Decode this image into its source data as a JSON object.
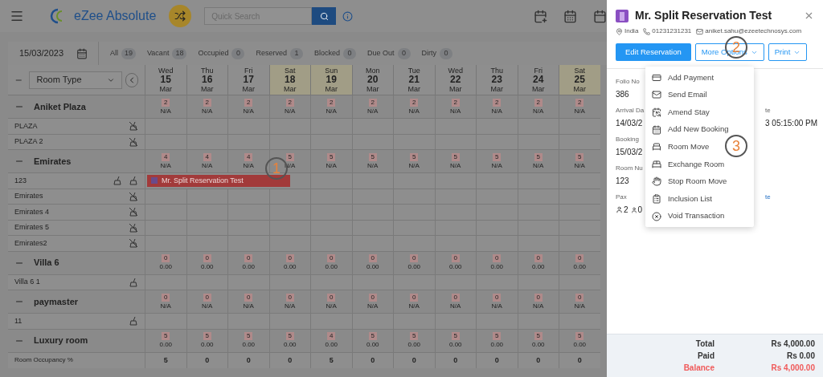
{
  "app": {
    "name": "eZee Absolute",
    "search": {
      "placeholder": "Quick Search"
    }
  },
  "filter_bar": {
    "date": "15/03/2023",
    "counts": [
      {
        "label": "All",
        "count": "19"
      },
      {
        "label": "Vacant",
        "count": "18"
      },
      {
        "label": "Occupied",
        "count": "0"
      },
      {
        "label": "Reserved",
        "count": "1"
      },
      {
        "label": "Blocked",
        "count": "0"
      },
      {
        "label": "Due Out",
        "count": "0"
      },
      {
        "label": "Dirty",
        "count": "0"
      }
    ]
  },
  "grid": {
    "room_type_select": "Room Type",
    "days": [
      {
        "weekday": "Wed",
        "day": "15",
        "month": "Mar",
        "weekend": false
      },
      {
        "weekday": "Thu",
        "day": "16",
        "month": "Mar",
        "weekend": false
      },
      {
        "weekday": "Fri",
        "day": "17",
        "month": "Mar",
        "weekend": false
      },
      {
        "weekday": "Sat",
        "day": "18",
        "month": "Mar",
        "weekend": true
      },
      {
        "weekday": "Sun",
        "day": "19",
        "month": "Mar",
        "weekend": true
      },
      {
        "weekday": "Mon",
        "day": "20",
        "month": "Mar",
        "weekend": false
      },
      {
        "weekday": "Tue",
        "day": "21",
        "month": "Mar",
        "weekend": false
      },
      {
        "weekday": "Wed",
        "day": "22",
        "month": "Mar",
        "weekend": false
      },
      {
        "weekday": "Thu",
        "day": "23",
        "month": "Mar",
        "weekend": false
      },
      {
        "weekday": "Fri",
        "day": "24",
        "month": "Mar",
        "weekend": false
      },
      {
        "weekday": "Sat",
        "day": "25",
        "month": "Mar",
        "weekend": true
      }
    ],
    "groups": [
      {
        "name": "Aniket Plaza",
        "availability": [
          "2",
          "2",
          "2",
          "2",
          "2",
          "2",
          "2",
          "2",
          "2",
          "2",
          "2"
        ],
        "rates": [
          "N/A",
          "N/A",
          "N/A",
          "N/A",
          "N/A",
          "N/A",
          "N/A",
          "N/A",
          "N/A",
          "N/A",
          "N/A"
        ],
        "rooms": [
          {
            "name": "PLAZA",
            "crossed": true,
            "extra_icon": false
          },
          {
            "name": "PLAZA 2",
            "crossed": true,
            "extra_icon": false
          }
        ]
      },
      {
        "name": "Emirates",
        "availability": [
          "4",
          "4",
          "4",
          "5",
          "5",
          "5",
          "5",
          "5",
          "5",
          "5",
          "5"
        ],
        "rates": [
          "N/A",
          "N/A",
          "N/A",
          "N/A",
          "N/A",
          "N/A",
          "N/A",
          "N/A",
          "N/A",
          "N/A",
          "N/A"
        ],
        "rooms": [
          {
            "name": "123",
            "crossed": false,
            "extra_icon": true,
            "reservation": {
              "guest": "Mr. Split Reservation Test"
            }
          },
          {
            "name": "Emirates",
            "crossed": true,
            "extra_icon": false
          },
          {
            "name": "Emirates 4",
            "crossed": true,
            "extra_icon": false
          },
          {
            "name": "Emirates 5",
            "crossed": true,
            "extra_icon": false
          },
          {
            "name": "Emirates2",
            "crossed": true,
            "extra_icon": false
          }
        ]
      },
      {
        "name": "Villa 6",
        "availability": [
          "0",
          "0",
          "0",
          "0",
          "0",
          "0",
          "0",
          "0",
          "0",
          "0",
          "0"
        ],
        "rates": [
          "0.00",
          "0.00",
          "0.00",
          "0.00",
          "0.00",
          "0.00",
          "0.00",
          "0.00",
          "0.00",
          "0.00",
          "0.00"
        ],
        "rooms": [
          {
            "name": "Villa 6 1",
            "crossed": false,
            "extra_icon": false
          }
        ]
      },
      {
        "name": "paymaster",
        "availability": [
          "0",
          "0",
          "0",
          "0",
          "0",
          "0",
          "0",
          "0",
          "0",
          "0",
          "0"
        ],
        "rates": [
          "N/A",
          "N/A",
          "N/A",
          "N/A",
          "N/A",
          "N/A",
          "N/A",
          "N/A",
          "N/A",
          "N/A",
          "N/A"
        ],
        "rooms": [
          {
            "name": "11",
            "crossed": false,
            "extra_icon": false
          }
        ]
      },
      {
        "name": "Luxury room",
        "availability": [
          "5",
          "5",
          "5",
          "5",
          "4",
          "5",
          "5",
          "5",
          "5",
          "5",
          "5"
        ],
        "rates": [
          "0.00",
          "0.00",
          "0.00",
          "0.00",
          "0.00",
          "0.00",
          "0.00",
          "0.00",
          "0.00",
          "0.00",
          "0.00"
        ]
      }
    ],
    "occupancy": {
      "label": "Room Occupancy %",
      "values": [
        "5",
        "0",
        "0",
        "0",
        "5",
        "0",
        "0",
        "0",
        "0",
        "0",
        "0"
      ]
    }
  },
  "panel": {
    "title": "Mr. Split Reservation Test",
    "country": "India",
    "phone": "01231231231",
    "email": "aniket.sahu@ezeetechnosys.com",
    "buttons": [
      {
        "label": "Edit Reservation",
        "kind": "primary"
      },
      {
        "label": "More Options",
        "kind": "dropdown"
      },
      {
        "label": "Print",
        "kind": "dropdown"
      }
    ],
    "details": [
      {
        "label": "Folio No",
        "value": "386"
      },
      {
        "label": "Arrival Da",
        "value": "14/03/2",
        "side": "te",
        "side_value": "3 05:15:00 PM"
      },
      {
        "label": "Booking",
        "value": "15/03/2"
      },
      {
        "label": "Room Nu",
        "value": "123"
      }
    ],
    "pax": {
      "label": "Pax",
      "adults": "2",
      "children": "0",
      "side": "te"
    },
    "menu": [
      "Add Payment",
      "Send Email",
      "Amend Stay",
      "Add New Booking",
      "Room Move",
      "Exchange Room",
      "Stop Room Move",
      "Inclusion List",
      "Void Transaction"
    ],
    "totals": [
      {
        "label": "Total",
        "value": "Rs 4,000.00",
        "alert": false
      },
      {
        "label": "Paid",
        "value": "Rs 0.00",
        "alert": false
      },
      {
        "label": "Balance",
        "value": "Rs 4,000.00",
        "alert": true
      }
    ]
  },
  "annotations": [
    "1",
    "2",
    "3"
  ]
}
